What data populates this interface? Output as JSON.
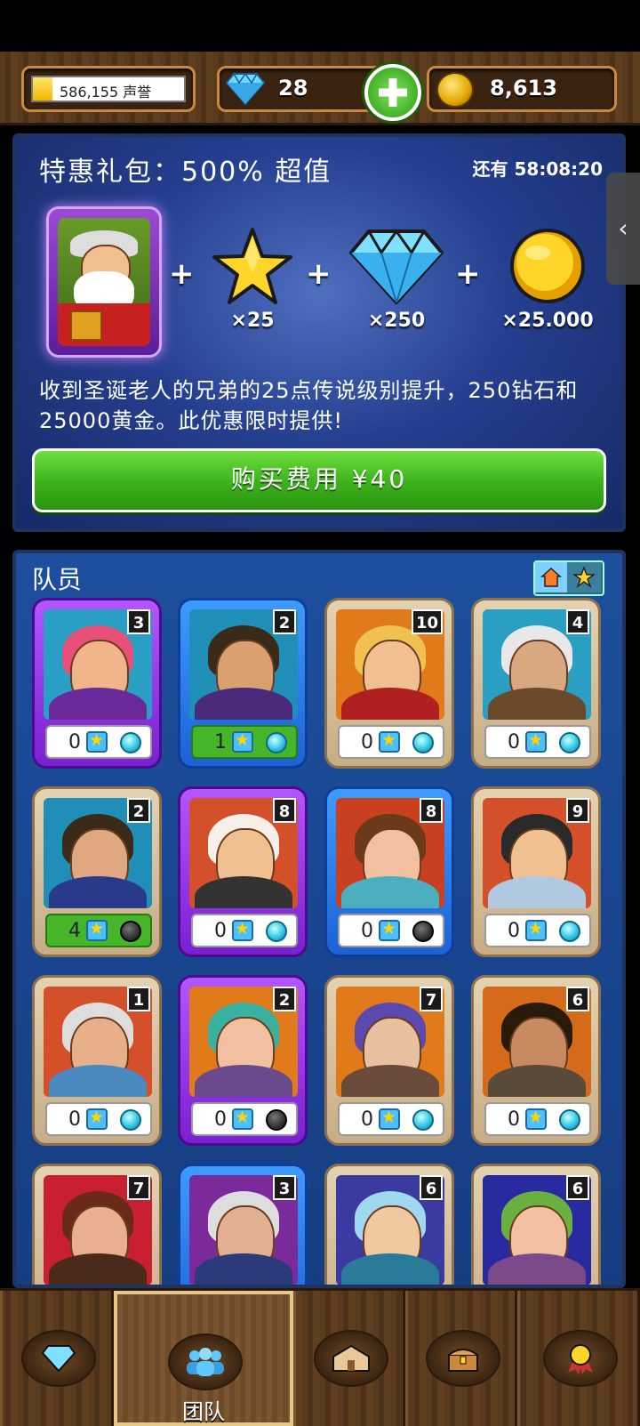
{
  "topbar": {
    "fame_text": "586,155 声誉",
    "gems": "28",
    "gold": "8,613"
  },
  "offer": {
    "title": "特惠礼包：500% 超值",
    "timer": "还有 58:08:20",
    "rewards": [
      {
        "icon": "star-icon",
        "qty": "×25"
      },
      {
        "icon": "diamond-icon",
        "qty": "×250"
      },
      {
        "icon": "gold-coin-icon",
        "qty": "×25.000"
      }
    ],
    "description": "收到圣诞老人的兄弟的25点传说级别提升，250钻石和25000黄金。此优惠限时提供!",
    "buy_label": "购买费用 ¥40"
  },
  "team": {
    "title": "队员",
    "members": [
      {
        "level": "3",
        "stars": "0",
        "frame": "purple",
        "orb": "cyan",
        "highlight": false
      },
      {
        "level": "2",
        "stars": "1",
        "frame": "blue",
        "orb": "cyan",
        "highlight": true
      },
      {
        "level": "10",
        "stars": "0",
        "frame": "tan",
        "orb": "cyan",
        "highlight": false
      },
      {
        "level": "4",
        "stars": "0",
        "frame": "tan",
        "orb": "cyan",
        "highlight": false
      },
      {
        "level": "2",
        "stars": "4",
        "frame": "tan",
        "orb": "dark",
        "highlight": true
      },
      {
        "level": "8",
        "stars": "0",
        "frame": "purple",
        "orb": "cyan",
        "highlight": false
      },
      {
        "level": "8",
        "stars": "0",
        "frame": "blue",
        "orb": "dark",
        "highlight": false
      },
      {
        "level": "9",
        "stars": "0",
        "frame": "tan",
        "orb": "cyan",
        "highlight": false
      },
      {
        "level": "1",
        "stars": "0",
        "frame": "tan",
        "orb": "cyan",
        "highlight": false
      },
      {
        "level": "2",
        "stars": "0",
        "frame": "purple",
        "orb": "dark",
        "highlight": false
      },
      {
        "level": "7",
        "stars": "0",
        "frame": "tan",
        "orb": "cyan",
        "highlight": false
      },
      {
        "level": "6",
        "stars": "0",
        "frame": "tan",
        "orb": "cyan",
        "highlight": false
      },
      {
        "level": "7",
        "stars": "",
        "frame": "tan",
        "orb": "",
        "highlight": false
      },
      {
        "level": "3",
        "stars": "",
        "frame": "blue",
        "orb": "",
        "highlight": false
      },
      {
        "level": "6",
        "stars": "",
        "frame": "tan",
        "orb": "",
        "highlight": false
      },
      {
        "level": "6",
        "stars": "",
        "frame": "tan",
        "orb": "",
        "highlight": false
      }
    ]
  },
  "nav": {
    "items": [
      {
        "icon": "diamond-icon",
        "label": ""
      },
      {
        "icon": "team-icon",
        "label": "团队"
      },
      {
        "icon": "buildings-icon",
        "label": ""
      },
      {
        "icon": "treasure-chest-icon",
        "label": ""
      },
      {
        "icon": "medal-icon",
        "label": ""
      }
    ]
  }
}
